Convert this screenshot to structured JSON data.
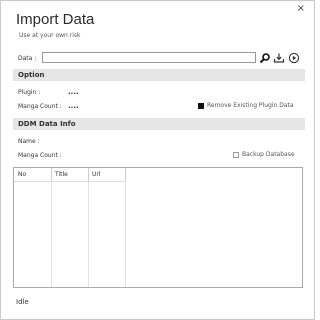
{
  "window": {
    "title": "Import Data",
    "subtitle": "Use at your own risk",
    "close_glyph": "×"
  },
  "data_row": {
    "label": "Data :",
    "value": "",
    "icons": [
      "search-icon",
      "download-icon",
      "play-icon"
    ]
  },
  "option": {
    "header": "Option",
    "plugin_label": "Plugin :",
    "plugin_value": "....",
    "manga_count_label": "Manga Count :",
    "manga_count_value": "....",
    "remove_label": "Remove Existing Plugin Data",
    "remove_checked": true
  },
  "ddm": {
    "header": "DDM Data Info",
    "name_label": "Name :",
    "manga_count_label": "Manga Count :",
    "backup_label": "Backup Database",
    "backup_checked": false
  },
  "table": {
    "columns": [
      "No",
      "Title",
      "Url"
    ]
  },
  "status": "Idle"
}
